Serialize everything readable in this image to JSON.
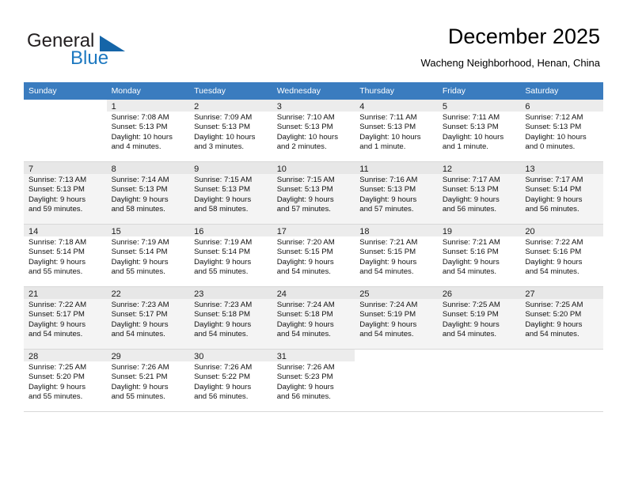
{
  "brand": {
    "name_part1": "General",
    "name_part2": "Blue",
    "accent_color": "#1c78c0"
  },
  "header": {
    "title": "December 2025",
    "subtitle": "Wacheng Neighborhood, Henan, China",
    "header_bg_color": "#3a7cbf"
  },
  "weekday_headers": [
    "Sunday",
    "Monday",
    "Tuesday",
    "Wednesday",
    "Thursday",
    "Friday",
    "Saturday"
  ],
  "weeks": [
    [
      {
        "day": "",
        "sunrise": "",
        "sunset": "",
        "daylight_line1": "",
        "daylight_line2": ""
      },
      {
        "day": "1",
        "sunrise": "Sunrise: 7:08 AM",
        "sunset": "Sunset: 5:13 PM",
        "daylight_line1": "Daylight: 10 hours",
        "daylight_line2": "and 4 minutes."
      },
      {
        "day": "2",
        "sunrise": "Sunrise: 7:09 AM",
        "sunset": "Sunset: 5:13 PM",
        "daylight_line1": "Daylight: 10 hours",
        "daylight_line2": "and 3 minutes."
      },
      {
        "day": "3",
        "sunrise": "Sunrise: 7:10 AM",
        "sunset": "Sunset: 5:13 PM",
        "daylight_line1": "Daylight: 10 hours",
        "daylight_line2": "and 2 minutes."
      },
      {
        "day": "4",
        "sunrise": "Sunrise: 7:11 AM",
        "sunset": "Sunset: 5:13 PM",
        "daylight_line1": "Daylight: 10 hours",
        "daylight_line2": "and 1 minute."
      },
      {
        "day": "5",
        "sunrise": "Sunrise: 7:11 AM",
        "sunset": "Sunset: 5:13 PM",
        "daylight_line1": "Daylight: 10 hours",
        "daylight_line2": "and 1 minute."
      },
      {
        "day": "6",
        "sunrise": "Sunrise: 7:12 AM",
        "sunset": "Sunset: 5:13 PM",
        "daylight_line1": "Daylight: 10 hours",
        "daylight_line2": "and 0 minutes."
      }
    ],
    [
      {
        "day": "7",
        "sunrise": "Sunrise: 7:13 AM",
        "sunset": "Sunset: 5:13 PM",
        "daylight_line1": "Daylight: 9 hours",
        "daylight_line2": "and 59 minutes."
      },
      {
        "day": "8",
        "sunrise": "Sunrise: 7:14 AM",
        "sunset": "Sunset: 5:13 PM",
        "daylight_line1": "Daylight: 9 hours",
        "daylight_line2": "and 58 minutes."
      },
      {
        "day": "9",
        "sunrise": "Sunrise: 7:15 AM",
        "sunset": "Sunset: 5:13 PM",
        "daylight_line1": "Daylight: 9 hours",
        "daylight_line2": "and 58 minutes."
      },
      {
        "day": "10",
        "sunrise": "Sunrise: 7:15 AM",
        "sunset": "Sunset: 5:13 PM",
        "daylight_line1": "Daylight: 9 hours",
        "daylight_line2": "and 57 minutes."
      },
      {
        "day": "11",
        "sunrise": "Sunrise: 7:16 AM",
        "sunset": "Sunset: 5:13 PM",
        "daylight_line1": "Daylight: 9 hours",
        "daylight_line2": "and 57 minutes."
      },
      {
        "day": "12",
        "sunrise": "Sunrise: 7:17 AM",
        "sunset": "Sunset: 5:13 PM",
        "daylight_line1": "Daylight: 9 hours",
        "daylight_line2": "and 56 minutes."
      },
      {
        "day": "13",
        "sunrise": "Sunrise: 7:17 AM",
        "sunset": "Sunset: 5:14 PM",
        "daylight_line1": "Daylight: 9 hours",
        "daylight_line2": "and 56 minutes."
      }
    ],
    [
      {
        "day": "14",
        "sunrise": "Sunrise: 7:18 AM",
        "sunset": "Sunset: 5:14 PM",
        "daylight_line1": "Daylight: 9 hours",
        "daylight_line2": "and 55 minutes."
      },
      {
        "day": "15",
        "sunrise": "Sunrise: 7:19 AM",
        "sunset": "Sunset: 5:14 PM",
        "daylight_line1": "Daylight: 9 hours",
        "daylight_line2": "and 55 minutes."
      },
      {
        "day": "16",
        "sunrise": "Sunrise: 7:19 AM",
        "sunset": "Sunset: 5:14 PM",
        "daylight_line1": "Daylight: 9 hours",
        "daylight_line2": "and 55 minutes."
      },
      {
        "day": "17",
        "sunrise": "Sunrise: 7:20 AM",
        "sunset": "Sunset: 5:15 PM",
        "daylight_line1": "Daylight: 9 hours",
        "daylight_line2": "and 54 minutes."
      },
      {
        "day": "18",
        "sunrise": "Sunrise: 7:21 AM",
        "sunset": "Sunset: 5:15 PM",
        "daylight_line1": "Daylight: 9 hours",
        "daylight_line2": "and 54 minutes."
      },
      {
        "day": "19",
        "sunrise": "Sunrise: 7:21 AM",
        "sunset": "Sunset: 5:16 PM",
        "daylight_line1": "Daylight: 9 hours",
        "daylight_line2": "and 54 minutes."
      },
      {
        "day": "20",
        "sunrise": "Sunrise: 7:22 AM",
        "sunset": "Sunset: 5:16 PM",
        "daylight_line1": "Daylight: 9 hours",
        "daylight_line2": "and 54 minutes."
      }
    ],
    [
      {
        "day": "21",
        "sunrise": "Sunrise: 7:22 AM",
        "sunset": "Sunset: 5:17 PM",
        "daylight_line1": "Daylight: 9 hours",
        "daylight_line2": "and 54 minutes."
      },
      {
        "day": "22",
        "sunrise": "Sunrise: 7:23 AM",
        "sunset": "Sunset: 5:17 PM",
        "daylight_line1": "Daylight: 9 hours",
        "daylight_line2": "and 54 minutes."
      },
      {
        "day": "23",
        "sunrise": "Sunrise: 7:23 AM",
        "sunset": "Sunset: 5:18 PM",
        "daylight_line1": "Daylight: 9 hours",
        "daylight_line2": "and 54 minutes."
      },
      {
        "day": "24",
        "sunrise": "Sunrise: 7:24 AM",
        "sunset": "Sunset: 5:18 PM",
        "daylight_line1": "Daylight: 9 hours",
        "daylight_line2": "and 54 minutes."
      },
      {
        "day": "25",
        "sunrise": "Sunrise: 7:24 AM",
        "sunset": "Sunset: 5:19 PM",
        "daylight_line1": "Daylight: 9 hours",
        "daylight_line2": "and 54 minutes."
      },
      {
        "day": "26",
        "sunrise": "Sunrise: 7:25 AM",
        "sunset": "Sunset: 5:19 PM",
        "daylight_line1": "Daylight: 9 hours",
        "daylight_line2": "and 54 minutes."
      },
      {
        "day": "27",
        "sunrise": "Sunrise: 7:25 AM",
        "sunset": "Sunset: 5:20 PM",
        "daylight_line1": "Daylight: 9 hours",
        "daylight_line2": "and 54 minutes."
      }
    ],
    [
      {
        "day": "28",
        "sunrise": "Sunrise: 7:25 AM",
        "sunset": "Sunset: 5:20 PM",
        "daylight_line1": "Daylight: 9 hours",
        "daylight_line2": "and 55 minutes."
      },
      {
        "day": "29",
        "sunrise": "Sunrise: 7:26 AM",
        "sunset": "Sunset: 5:21 PM",
        "daylight_line1": "Daylight: 9 hours",
        "daylight_line2": "and 55 minutes."
      },
      {
        "day": "30",
        "sunrise": "Sunrise: 7:26 AM",
        "sunset": "Sunset: 5:22 PM",
        "daylight_line1": "Daylight: 9 hours",
        "daylight_line2": "and 56 minutes."
      },
      {
        "day": "31",
        "sunrise": "Sunrise: 7:26 AM",
        "sunset": "Sunset: 5:23 PM",
        "daylight_line1": "Daylight: 9 hours",
        "daylight_line2": "and 56 minutes."
      },
      {
        "day": "",
        "sunrise": "",
        "sunset": "",
        "daylight_line1": "",
        "daylight_line2": ""
      },
      {
        "day": "",
        "sunrise": "",
        "sunset": "",
        "daylight_line1": "",
        "daylight_line2": ""
      },
      {
        "day": "",
        "sunrise": "",
        "sunset": "",
        "daylight_line1": "",
        "daylight_line2": ""
      }
    ]
  ]
}
